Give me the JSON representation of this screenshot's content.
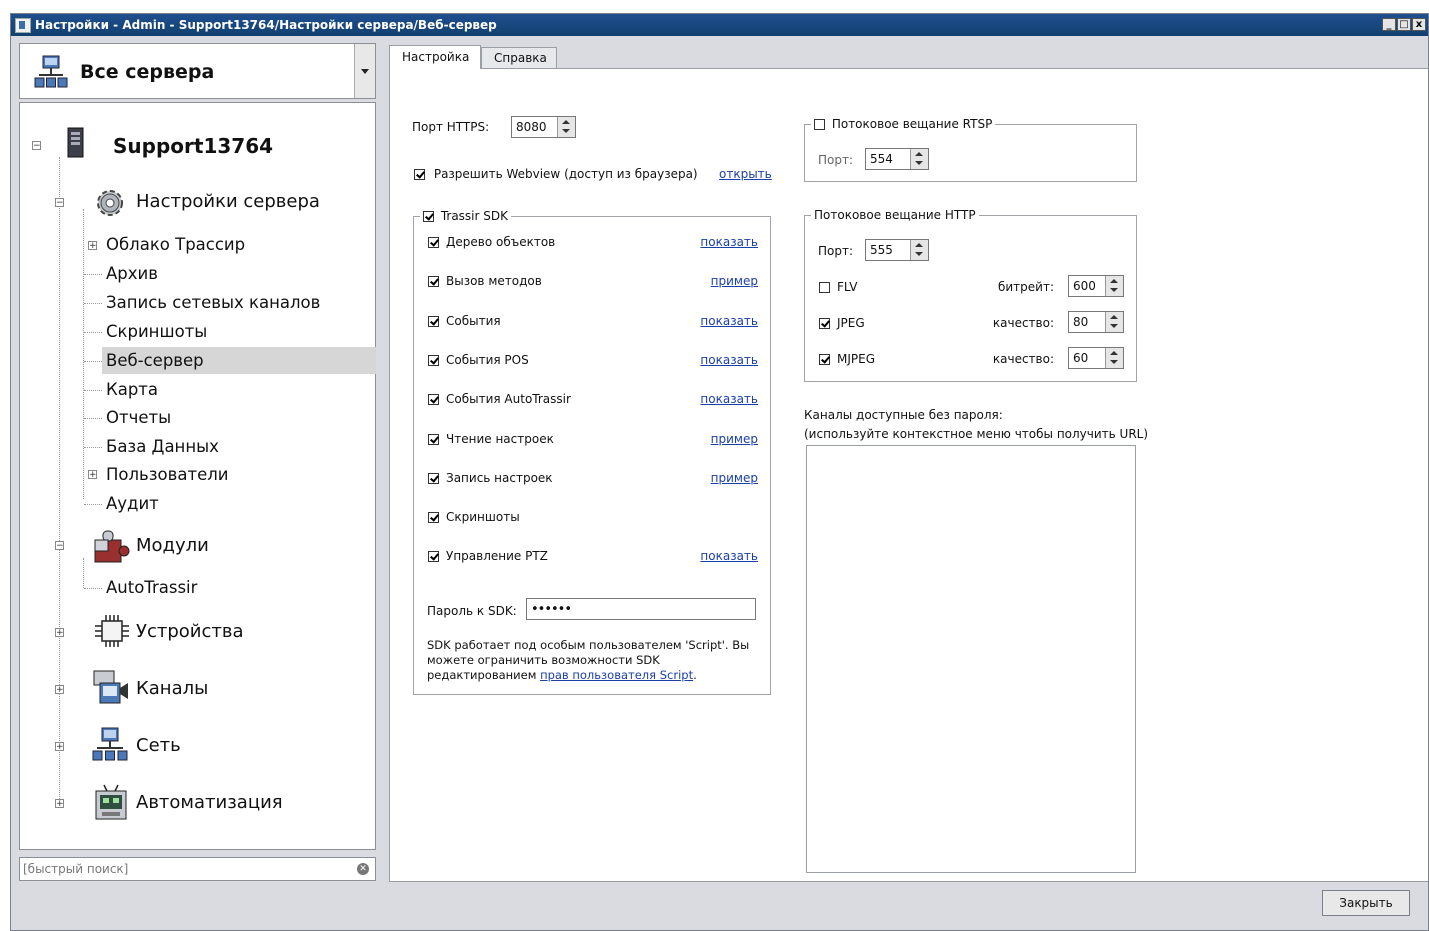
{
  "window": {
    "title": "Настройки - Admin - Support13764/Настройки сервера/Веб-сервер",
    "min": "_",
    "max": "□",
    "close": "x"
  },
  "server_combo": {
    "label": "Все сервера"
  },
  "tree": {
    "server": "Support13764",
    "server_settings": "Настройки сервера",
    "items": [
      "Облако Трассир",
      "Архив",
      "Запись сетевых каналов",
      "Скриншоты",
      "Веб-сервер",
      "Карта",
      "Отчеты",
      "База Данных",
      "Пользователи",
      "Аудит"
    ],
    "modules": "Модули",
    "modules_items": [
      "AutoTrassir"
    ],
    "devices": "Устройства",
    "channels": "Каналы",
    "network": "Сеть",
    "automation": "Автоматизация"
  },
  "search": {
    "placeholder": "[быстрый поиск]"
  },
  "tabs": [
    "Настройка",
    "Справка"
  ],
  "web": {
    "https_port_label": "Порт HTTPS:",
    "https_port": "8080",
    "webview_label": "Разрешить Webview (доступ из браузера)",
    "webview_checked": true,
    "webview_link": "открыть"
  },
  "sdk": {
    "legend": "Trassir SDK",
    "checked": true,
    "rows": [
      {
        "label": "Дерево объектов",
        "checked": true,
        "link": "показать"
      },
      {
        "label": "Вызов методов",
        "checked": true,
        "link": "пример"
      },
      {
        "label": "События",
        "checked": true,
        "link": "показать"
      },
      {
        "label": "События POS",
        "checked": true,
        "link": "показать"
      },
      {
        "label": "События AutoTrassir",
        "checked": true,
        "link": "показать"
      },
      {
        "label": "Чтение настроек",
        "checked": true,
        "link": "пример"
      },
      {
        "label": "Запись настроек",
        "checked": true,
        "link": "пример"
      },
      {
        "label": "Скриншоты",
        "checked": true,
        "link": ""
      },
      {
        "label": "Управление PTZ",
        "checked": true,
        "link": "показать"
      }
    ],
    "password_label": "Пароль к SDK:",
    "password_value": "••••••",
    "note_line1": "SDK работает под особым пользователем 'Script'. Вы",
    "note_line2": "можете ограничить возможности SDK",
    "note_line3_prefix": "редактированием",
    "note_link": "прав пользователя Script",
    "note_suffix": "."
  },
  "rtsp": {
    "legend": "Потоковое вещание RTSP",
    "checked": false,
    "port_label": "Порт:",
    "port": "554"
  },
  "http": {
    "legend": "Потоковое вещание HTTP",
    "port_label": "Порт:",
    "port": "555",
    "rows": [
      {
        "label": "FLV",
        "checked": false,
        "param_label": "битрейт:",
        "value": "600"
      },
      {
        "label": "JPEG",
        "checked": true,
        "param_label": "качество:",
        "value": "80"
      },
      {
        "label": "MJPEG",
        "checked": true,
        "param_label": "качество:",
        "value": "60"
      }
    ]
  },
  "channels_free": {
    "line1": "Каналы доступные без пароля:",
    "line2": "(используйте контекстное меню чтобы получить URL)"
  },
  "close_button": "Закрыть"
}
